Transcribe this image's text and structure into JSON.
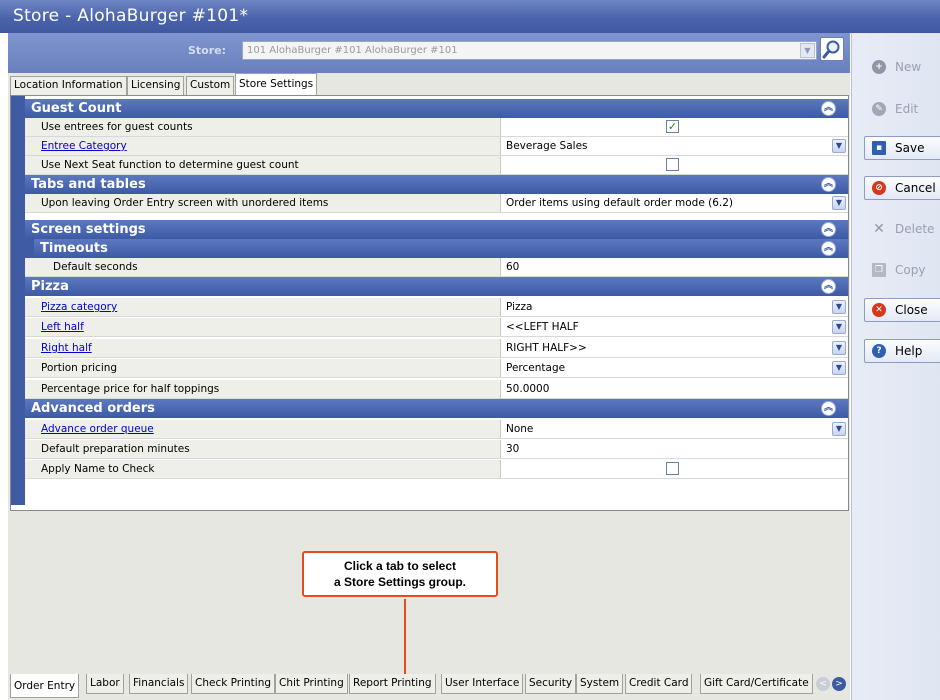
{
  "window": {
    "title": "Store - AlohaBurger #101*"
  },
  "store": {
    "label": "Store:",
    "value": "101 AlohaBurger #101 AlohaBurger #101"
  },
  "top_tabs": [
    "Location Information",
    "Licensing",
    "Custom",
    "Store Settings"
  ],
  "groups": {
    "guest_count": {
      "title": "Guest Count",
      "rows": [
        {
          "label": "Use entrees for guest counts",
          "value": "",
          "checked": true
        },
        {
          "label": "Entree Category",
          "value": "Beverage Sales"
        },
        {
          "label": "Use Next Seat function to determine guest count",
          "value": "",
          "checked": false
        }
      ]
    },
    "tabs_tables": {
      "title": "Tabs and tables",
      "rows": [
        {
          "label": "Upon leaving Order Entry screen with unordered items",
          "value": "Order items using default order mode (6.2)"
        }
      ]
    },
    "screen_settings": {
      "title": "Screen settings",
      "timeouts": {
        "title": "Timeouts",
        "rows": [
          {
            "label": "Default seconds",
            "value": "60"
          }
        ]
      }
    },
    "pizza": {
      "title": "Pizza",
      "rows": [
        {
          "label": "Pizza category",
          "value": "Pizza"
        },
        {
          "label": "Left half",
          "value": "<<LEFT HALF"
        },
        {
          "label": "Right half",
          "value": "RIGHT HALF>>"
        },
        {
          "label": "Portion pricing",
          "value": "Percentage"
        },
        {
          "label": "Percentage price for half toppings",
          "value": "50.0000"
        }
      ]
    },
    "advanced_orders": {
      "title": "Advanced orders",
      "rows": [
        {
          "label": "Advance order queue",
          "value": "None"
        },
        {
          "label": "Default preparation minutes",
          "value": "30"
        },
        {
          "label": "Apply Name to Check",
          "value": "",
          "checked": false
        }
      ]
    }
  },
  "callout": {
    "line1": "Click a tab to select",
    "line2": "a Store Settings group."
  },
  "bottom_tabs": [
    "Order Entry",
    "Labor",
    "Financials",
    "Check Printing",
    "Chit Printing",
    "Report Printing",
    "User Interface",
    "Security",
    "System",
    "Credit Card",
    "Gift Card/Certificate"
  ],
  "toolbar": {
    "new": "New",
    "edit": "Edit",
    "save": "Save",
    "cancel": "Cancel",
    "delete": "Delete",
    "copy": "Copy",
    "close": "Close",
    "help": "Help"
  },
  "colors": {
    "header_blue": "#3d5aa5",
    "callout_red": "#e54d1b",
    "check_green": "#1e8a1e"
  }
}
